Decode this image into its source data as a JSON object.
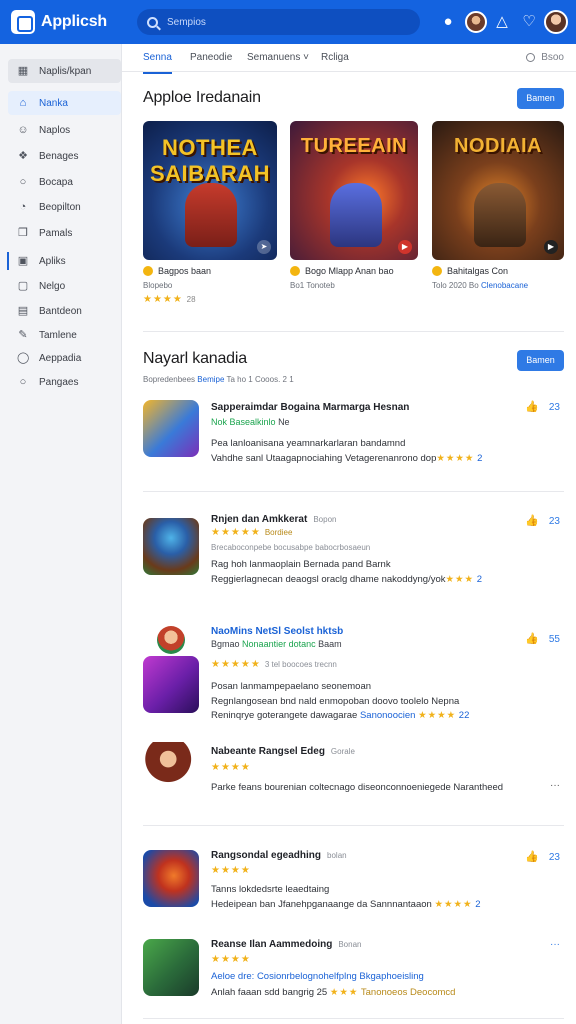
{
  "app": {
    "name": "Applicsh"
  },
  "search": {
    "placeholder": "Sempios"
  },
  "sidebar": {
    "items": [
      {
        "label": "Naplis/kpan",
        "icon": "grid-icon"
      },
      {
        "label": "Nanka",
        "icon": "home-icon"
      },
      {
        "label": "Naplos",
        "icon": "user-icon"
      },
      {
        "label": "Benages",
        "icon": "layers-icon"
      },
      {
        "label": "Bocapa",
        "icon": "compass-icon"
      },
      {
        "label": "Beopilton",
        "icon": "clock-icon"
      },
      {
        "label": "Pamals",
        "icon": "puzzle-icon"
      },
      {
        "label": "Apliks",
        "icon": "folder-icon"
      },
      {
        "label": "Nelgo",
        "icon": "bookmark-icon"
      },
      {
        "label": "Bantdeon",
        "icon": "list-icon"
      },
      {
        "label": "Tamlene",
        "icon": "pencil-icon"
      },
      {
        "label": "Aeppadia",
        "icon": "circle-icon"
      },
      {
        "label": "Pangaes",
        "icon": "help-icon"
      }
    ]
  },
  "tabs": [
    {
      "label": "Senna"
    },
    {
      "label": "Paneodie"
    },
    {
      "label": "Semanuens ˅"
    },
    {
      "label": "Rcliga"
    }
  ],
  "tab_search": "Bsoo",
  "featured": {
    "title": "Apploe Iredanain",
    "button": "Bamen",
    "cards": [
      {
        "art_title": "NOTHEA SAIBARAH",
        "name": "Bagpos baan",
        "sub_left": "Blopebo",
        "sub_link": "",
        "stars": "★★★★",
        "rating": "28"
      },
      {
        "art_title": "TUREEAIN",
        "name": "Bogo Mlapp Anan bao",
        "sub_left": "Bo1 Tonoteb",
        "sub_link": "",
        "stars": "",
        "rating": ""
      },
      {
        "art_title": "NODIAIA",
        "name": "Bahitalgas Con",
        "sub_left": "Tolo 2020 Bo",
        "sub_link": "Clenobacane",
        "stars": "",
        "rating": ""
      }
    ]
  },
  "list_section": {
    "title": "Nayarl kanadia",
    "button": "Bamen",
    "filters": {
      "left": "Bopredenbees",
      "link": "Bemipe",
      "right": "Ta ho 1 Cooos. 2 1"
    },
    "items": [
      {
        "title": "Sapperaimdar Bogaina Marmarga Hesnan",
        "meta": "",
        "sub_green": "Nok Basealkinlo",
        "sub_rest": "Ne",
        "line1": "Pea lanloanisana yeamnarkarlaran bandamnd",
        "line2": "Vahdhe sanl Utaagapnociahing Vetagerenanrono dop",
        "line2_stars": "★★★★",
        "line2_num": "2",
        "act_count": "23"
      },
      {
        "title": "Rnjen dan Amkkerat",
        "meta": "Bopon",
        "stars": "★★★★★",
        "stars_txt": "Bordiee",
        "sub_small": "Brecaboconpebe bocusabpe babocrbosaeun",
        "line1": "Rag hoh lanmaoplain Bernada pand Barnk",
        "line2": "Reggierlagnecan deaogsl oraclg dhame nakoddyng/yok",
        "line2_stars": "★★★",
        "line2_num": "2",
        "act_count": "23"
      },
      {
        "title": "NaoMins NetSl Seolst hktsb",
        "meta": "",
        "sub_mixed": "Bgmao",
        "sub_green": "Nonaantier dotanc",
        "sub_rest": "Baam",
        "stars": "★★★★★",
        "stars_txt": "3 tel boocoes trecnn",
        "line1": "Posan lanmampepaelano seonemoan",
        "line2": "Regnlangosean bnd nald enmopoban doovo toolelo Nepna",
        "line3": "Reninqrye goterangete dawagarae",
        "line3_link": "Sanonoocien",
        "line3_stars": "★★★★",
        "line3_num": "22",
        "act_count": "55"
      },
      {
        "title": "Nabeante Rangsel Edeg",
        "meta": "Gorale",
        "stars": "★★★★",
        "stars_txt": "",
        "line1": "Parke feans bourenian coltecnago diseonconnoeniegede Narantheed",
        "act_count": ""
      },
      {
        "title": "Rangsondal egeadhing",
        "meta": "bolan",
        "stars": "★★★★",
        "stars_txt": "",
        "line1": "Tanns lokdedsrte leaedtaing",
        "line2": "Hedeipean ban Jfanehpganaange da Sannnantaaon",
        "line2_stars": "★★★★",
        "line2_num": "2",
        "act_count": "23"
      },
      {
        "title": "Reanse Ilan Aammedoing",
        "meta": "Bonan",
        "stars": "★★★★",
        "stars_txt": "",
        "line1": "Aeloe dre: Cosionrbelognohelfplng Bkgaphoeisling",
        "line2": "Anlah faaan sdd bangrig 25",
        "line2_stars": "★★★",
        "line2_link": "Tanonoeos Deocomcd",
        "act_count": ""
      }
    ]
  },
  "colors": {
    "primary": "#1463e0",
    "accent": "#2f7ae5",
    "star": "#f1b21b",
    "green": "#1ba44e"
  }
}
